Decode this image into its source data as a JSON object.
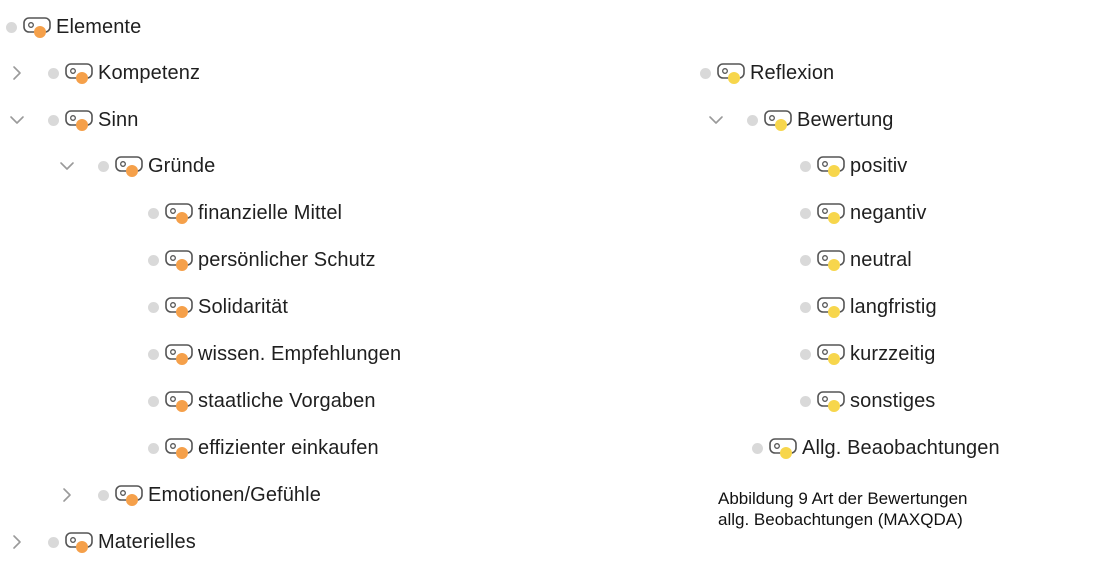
{
  "colors": {
    "orange": "#f5a04a",
    "yellow": "#f7d64c",
    "chevron": "#9a9a9a",
    "grey_dot": "#d9d9d9"
  },
  "left_tree": [
    {
      "label": "Elemente",
      "chevron": "none",
      "color": "orange"
    },
    {
      "label": "Kompetenz",
      "chevron": "collapsed",
      "color": "orange"
    },
    {
      "label": "Sinn",
      "chevron": "expanded",
      "color": "orange"
    },
    {
      "label": "Gründe",
      "chevron": "expanded",
      "color": "orange"
    },
    {
      "label": "finanzielle Mittel",
      "chevron": "none",
      "color": "orange"
    },
    {
      "label": "persönlicher Schutz",
      "chevron": "none",
      "color": "orange"
    },
    {
      "label": "Solidarität",
      "chevron": "none",
      "color": "orange"
    },
    {
      "label": "wissen. Empfehlungen",
      "chevron": "none",
      "color": "orange"
    },
    {
      "label": "staatliche Vorgaben",
      "chevron": "none",
      "color": "orange"
    },
    {
      "label": "effizienter einkaufen",
      "chevron": "none",
      "color": "orange"
    },
    {
      "label": "Emotionen/Gefühle",
      "chevron": "collapsed",
      "color": "orange"
    },
    {
      "label": "Materielles",
      "chevron": "collapsed",
      "color": "orange"
    }
  ],
  "right_tree": [
    {
      "label": "Reflexion",
      "chevron": "none",
      "color": "yellow"
    },
    {
      "label": "Bewertung",
      "chevron": "expanded",
      "color": "yellow"
    },
    {
      "label": "positiv",
      "chevron": "none",
      "color": "yellow"
    },
    {
      "label": "negantiv",
      "chevron": "none",
      "color": "yellow"
    },
    {
      "label": "neutral",
      "chevron": "none",
      "color": "yellow"
    },
    {
      "label": "langfristig",
      "chevron": "none",
      "color": "yellow"
    },
    {
      "label": "kurzzeitig",
      "chevron": "none",
      "color": "yellow"
    },
    {
      "label": "sonstiges",
      "chevron": "none",
      "color": "yellow"
    },
    {
      "label": "Allg. Beaobachtungen",
      "chevron": "none",
      "color": "yellow"
    }
  ],
  "caption": {
    "line1": "Abbildung 9 Art der Bewertungen",
    "line2": "allg. Beobachtungen (MAXQDA)"
  }
}
